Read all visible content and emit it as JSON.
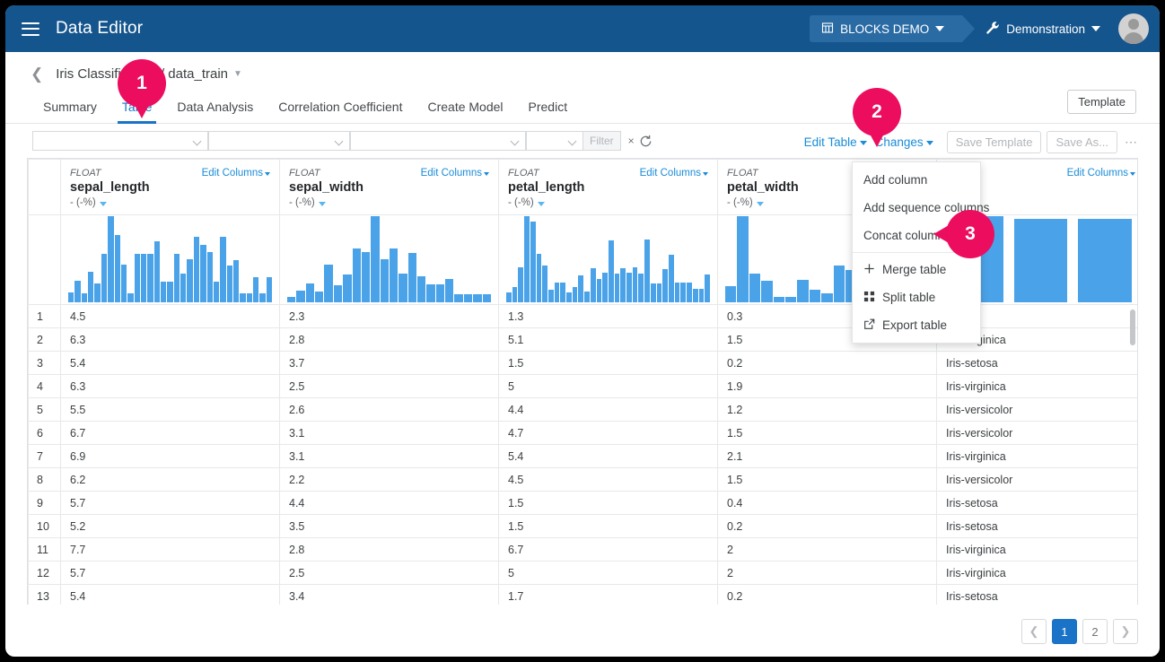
{
  "appbar": {
    "title": "Data Editor",
    "menu_icon": "hamburger-icon",
    "project_chip": {
      "label": "BLOCKS DEMO",
      "icon": "building-icon"
    },
    "env_chip": {
      "label": "Demonstration",
      "icon": "wrench-icon"
    },
    "avatar_icon": "user-avatar-icon"
  },
  "breadcrumb": {
    "back_icon": "chevron-left-icon",
    "text": "Iris Classification / data_train",
    "caret_icon": "chevron-down-icon"
  },
  "tabs": [
    {
      "label": "Summary",
      "active": false
    },
    {
      "label": "Table",
      "active": true
    },
    {
      "label": "Data Analysis",
      "active": false
    },
    {
      "label": "Correlation Coefficient",
      "active": false
    },
    {
      "label": "Create Model",
      "active": false
    },
    {
      "label": "Predict",
      "active": false
    }
  ],
  "template_button": "Template",
  "filter_bar": {
    "select_1": "",
    "select_2": "",
    "select_3": "",
    "select_4": "",
    "filter_button": "Filter",
    "clear_label": "×",
    "refresh_icon": "refresh-icon"
  },
  "toolbar": {
    "edit_table": "Edit Table",
    "changes": "Changes",
    "save_template": "Save Template",
    "save_as": "Save As...",
    "overflow": "⋯"
  },
  "edit_table_menu": [
    {
      "label": "Add column",
      "icon": ""
    },
    {
      "label": "Add sequence columns",
      "icon": ""
    },
    {
      "label": "Concat columns",
      "icon": ""
    },
    {
      "label": "Merge table",
      "icon": "plus-icon",
      "glyph": "＋",
      "separator_before": true
    },
    {
      "label": "Split table",
      "icon": "grid-split-icon",
      "glyph": "░"
    },
    {
      "label": "Export table",
      "icon": "export-icon",
      "glyph": "↗"
    }
  ],
  "table": {
    "edit_columns_label": "Edit Columns",
    "stat_label": "- (-%)",
    "columns": [
      {
        "type": "FLOAT",
        "name": "sepal_length"
      },
      {
        "type": "FLOAT",
        "name": "sepal_width"
      },
      {
        "type": "FLOAT",
        "name": "petal_length"
      },
      {
        "type": "FLOAT",
        "name": "petal_width"
      },
      {
        "type": "",
        "name": ""
      }
    ],
    "rows": [
      {
        "idx": "1",
        "sepal_length": "4.5",
        "sepal_width": "2.3",
        "petal_length": "1.3",
        "petal_width": "0.3",
        "class": ""
      },
      {
        "idx": "2",
        "sepal_length": "6.3",
        "sepal_width": "2.8",
        "petal_length": "5.1",
        "petal_width": "1.5",
        "class": "Iris-virginica"
      },
      {
        "idx": "3",
        "sepal_length": "5.4",
        "sepal_width": "3.7",
        "petal_length": "1.5",
        "petal_width": "0.2",
        "class": "Iris-setosa"
      },
      {
        "idx": "4",
        "sepal_length": "6.3",
        "sepal_width": "2.5",
        "petal_length": "5",
        "petal_width": "1.9",
        "class": "Iris-virginica"
      },
      {
        "idx": "5",
        "sepal_length": "5.5",
        "sepal_width": "2.6",
        "petal_length": "4.4",
        "petal_width": "1.2",
        "class": "Iris-versicolor"
      },
      {
        "idx": "6",
        "sepal_length": "6.7",
        "sepal_width": "3.1",
        "petal_length": "4.7",
        "petal_width": "1.5",
        "class": "Iris-versicolor"
      },
      {
        "idx": "7",
        "sepal_length": "6.9",
        "sepal_width": "3.1",
        "petal_length": "5.4",
        "petal_width": "2.1",
        "class": "Iris-virginica"
      },
      {
        "idx": "8",
        "sepal_length": "6.2",
        "sepal_width": "2.2",
        "petal_length": "4.5",
        "petal_width": "1.5",
        "class": "Iris-versicolor"
      },
      {
        "idx": "9",
        "sepal_length": "5.7",
        "sepal_width": "4.4",
        "petal_length": "1.5",
        "petal_width": "0.4",
        "class": "Iris-setosa"
      },
      {
        "idx": "10",
        "sepal_length": "5.2",
        "sepal_width": "3.5",
        "petal_length": "1.5",
        "petal_width": "0.2",
        "class": "Iris-setosa"
      },
      {
        "idx": "11",
        "sepal_length": "7.7",
        "sepal_width": "2.8",
        "petal_length": "6.7",
        "petal_width": "2",
        "class": "Iris-virginica"
      },
      {
        "idx": "12",
        "sepal_length": "5.7",
        "sepal_width": "2.5",
        "petal_length": "5",
        "petal_width": "2",
        "class": "Iris-virginica"
      },
      {
        "idx": "13",
        "sepal_length": "5.4",
        "sepal_width": "3.4",
        "petal_length": "1.7",
        "petal_width": "0.2",
        "class": "Iris-setosa"
      }
    ]
  },
  "histograms": {
    "bar_color": "#4aa3e8",
    "sepal_length": [
      8,
      17,
      7,
      24,
      15,
      38,
      68,
      53,
      30,
      7,
      38,
      38,
      38,
      48,
      16,
      16,
      38,
      23,
      34,
      52,
      45,
      40,
      16,
      52,
      29,
      33,
      7,
      7,
      20,
      7,
      20
    ],
    "sepal_width": [
      6,
      14,
      22,
      13,
      44,
      20,
      32,
      62,
      58,
      100,
      50,
      63,
      33,
      57,
      30,
      21,
      21,
      27,
      9,
      9,
      9,
      9
    ],
    "petal_length": [
      9,
      14,
      32,
      78,
      73,
      44,
      33,
      11,
      18,
      18,
      9,
      14,
      24,
      10,
      31,
      21,
      27,
      56,
      26,
      31,
      27,
      32,
      26,
      57,
      17,
      17,
      30,
      43,
      18,
      18,
      18,
      12,
      12,
      25
    ],
    "petal_width": [
      17,
      93,
      31,
      23,
      6,
      6,
      24,
      14,
      10,
      40,
      35,
      40,
      15,
      10,
      39,
      13,
      22
    ],
    "class": [
      96,
      93,
      93
    ]
  },
  "pagination": {
    "prev_icon": "chevron-left-icon",
    "pages": [
      "1",
      "2"
    ],
    "active_page": "1",
    "next_icon": "chevron-right-icon"
  },
  "markers": [
    {
      "number": "1",
      "target": "Table tab"
    },
    {
      "number": "2",
      "target": "Edit Table"
    },
    {
      "number": "3",
      "target": "Concat columns"
    }
  ],
  "colors": {
    "appbar": "#15558d",
    "accent_link": "#1a8cd8",
    "marker": "#ec0d5e",
    "bar": "#4aa3e8",
    "active_page": "#1a73c7"
  }
}
